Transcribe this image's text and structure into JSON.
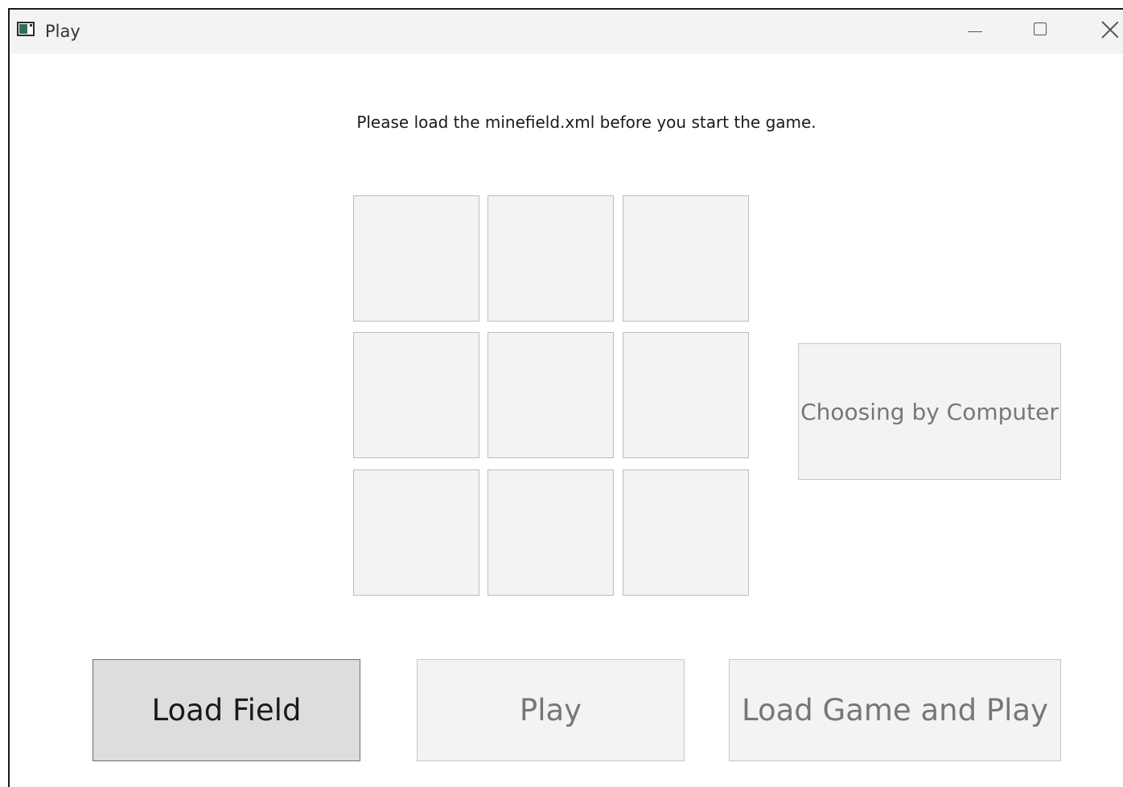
{
  "window": {
    "title": "Play"
  },
  "message": "Please load the minefield.xml before you start the game.",
  "grid": {
    "rows": 3,
    "cols": 3,
    "cells": [
      "",
      "",
      "",
      "",
      "",
      "",
      "",
      "",
      ""
    ]
  },
  "buttons": {
    "choosing_by_computer": "Choosing by Computer",
    "load_field": "Load Field",
    "play": "Play",
    "load_game_and_play": "Load Game and Play"
  },
  "colors": {
    "cell_background": "#f3f3f3",
    "active_button_background": "#dddddd",
    "disabled_text": "#777777"
  }
}
